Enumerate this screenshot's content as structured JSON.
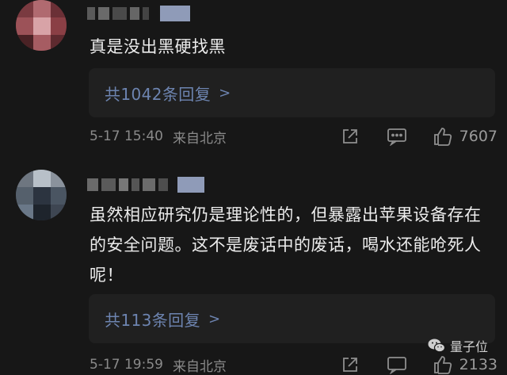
{
  "comments": [
    {
      "text": "真是没出黑硬找黑",
      "reply_summary": "共1042条回复",
      "reply_chevron": ">",
      "time": "5-17 15:40",
      "location": "来自北京",
      "likes": "7607"
    },
    {
      "text": "虽然相应研究仍是理论性的，但暴露出苹果设备存在的安全问题。这不是废话中的废话，喝水还能呛死人呢！",
      "reply_summary": "共113条回复",
      "reply_chevron": ">",
      "time": "5-17 19:59",
      "location": "来自北京",
      "likes": "2133"
    }
  ],
  "watermark": {
    "text": "量子位"
  },
  "icons": {
    "share": "share-icon",
    "comment": "comment-icon",
    "like": "thumbs-up-icon",
    "brand": "wechat-logo-icon"
  },
  "colors": {
    "background": "#171717",
    "reply_box": "#202020",
    "link": "#6d84b0",
    "meta": "#8a8a8a"
  }
}
